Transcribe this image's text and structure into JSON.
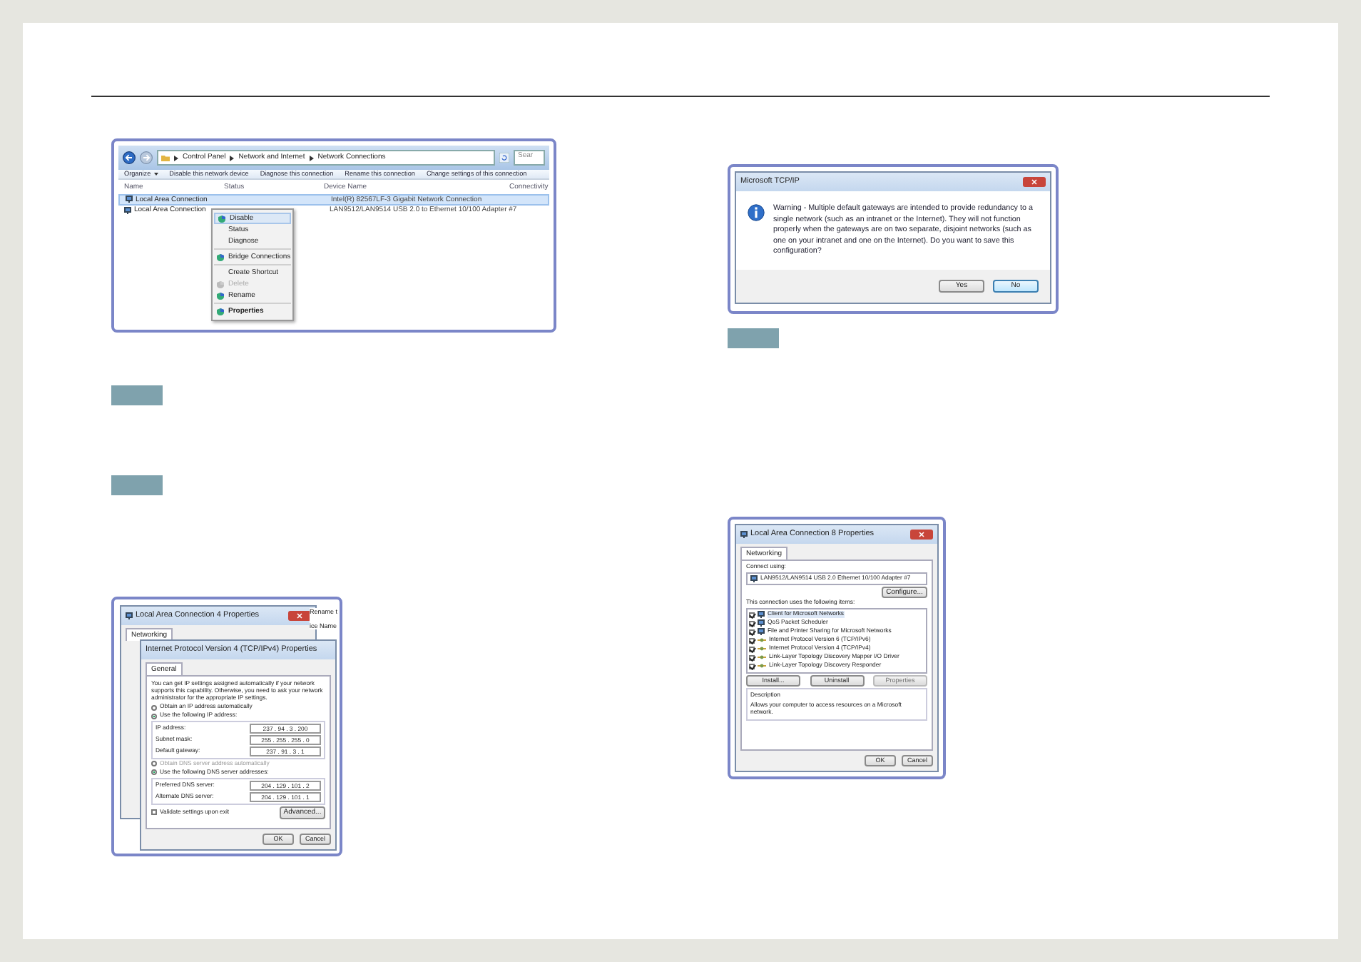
{
  "explorer": {
    "breadcrumb": [
      "Control Panel",
      "Network and Internet",
      "Network Connections"
    ],
    "search": "Sear",
    "toolbar": [
      "Organize",
      "Disable this network device",
      "Diagnose this connection",
      "Rename this connection",
      "Change settings of this connection"
    ],
    "columns": [
      "Name",
      "Status",
      "Device Name",
      "Connectivity"
    ],
    "rows": [
      {
        "name": "Local Area Connection",
        "device": "Intel(R) 82567LF-3 Gigabit Network Connection",
        "selected": true
      },
      {
        "name": "Local Area Connection",
        "device": "LAN9512/LAN9514 USB 2.0 to Ethernet 10/100 Adapter #7",
        "selected": false
      }
    ],
    "menu": [
      [
        {
          "label": "Disable",
          "kind": "shield",
          "selected": true,
          "disabled": false,
          "default": false
        },
        {
          "label": "Status",
          "kind": "plain",
          "selected": false,
          "disabled": false,
          "default": false
        },
        {
          "label": "Diagnose",
          "kind": "plain",
          "selected": false,
          "disabled": false,
          "default": false
        }
      ],
      [
        {
          "label": "Bridge Connections",
          "kind": "shield",
          "selected": false,
          "disabled": false,
          "default": false
        }
      ],
      [
        {
          "label": "Create Shortcut",
          "kind": "plain",
          "selected": false,
          "disabled": false,
          "default": false
        },
        {
          "label": "Delete",
          "kind": "shield",
          "selected": false,
          "disabled": true,
          "default": false
        },
        {
          "label": "Rename",
          "kind": "shield",
          "selected": false,
          "disabled": false,
          "default": false
        }
      ],
      [
        {
          "label": "Properties",
          "kind": "shield",
          "selected": false,
          "disabled": false,
          "default": true
        }
      ]
    ]
  },
  "warning": {
    "title": "Microsoft TCP/IP",
    "message": "Warning - Multiple default gateways are intended to provide redundancy to a single network (such as an intranet or the Internet). They will not function properly when the gateways are on two separate, disjoint networks (such as one on your intranet and one on the Internet). Do you want to save this configuration?",
    "buttons": [
      {
        "label": "Yes",
        "selected": false
      },
      {
        "label": "No",
        "selected": true
      }
    ]
  },
  "ipv4": {
    "back_title": "Local Area Connection 4 Properties",
    "back_tab": "Networking",
    "behind_button": "Rename t",
    "behind_column": "ice Name",
    "title": "Internet Protocol Version 4 (TCP/IPv4) Properties",
    "tab": "General",
    "intro": "You can get IP settings assigned automatically if your network supports this capability. Otherwise, you need to ask your network administrator for the appropriate IP settings.",
    "ip_options": [
      {
        "label": "Obtain an IP address automatically",
        "selected": false,
        "disabled": false
      },
      {
        "label": "Use the following IP address:",
        "selected": true,
        "disabled": false
      }
    ],
    "ip_fields": [
      {
        "label": "IP address:",
        "value": "237 . 94 . 3 . 200"
      },
      {
        "label": "Subnet mask:",
        "value": "255 . 255 . 255 . 0"
      },
      {
        "label": "Default gateway:",
        "value": "237 . 91 . 3 . 1"
      }
    ],
    "dns_options": [
      {
        "label": "Obtain DNS server address automatically",
        "selected": false,
        "disabled": true
      },
      {
        "label": "Use the following DNS server addresses:",
        "selected": true,
        "disabled": false
      }
    ],
    "dns_fields": [
      {
        "label": "Preferred DNS server:",
        "value": "204 . 129 . 101 . 2"
      },
      {
        "label": "Alternate DNS server:",
        "value": "204 . 129 . 101 . 1"
      }
    ],
    "validate": {
      "label": "Validate settings upon exit",
      "checked": false
    },
    "advanced": "Advanced...",
    "buttons": [
      "OK",
      "Cancel"
    ]
  },
  "properties": {
    "title": "Local Area Connection 8 Properties",
    "tab": "Networking",
    "connect_label": "Connect using:",
    "adapter": "LAN9512/LAN9514 USB 2.0 Ethernet 10/100 Adapter #7",
    "configure": "Configure...",
    "items_label": "This connection uses the following items:",
    "items": [
      {
        "label": "Client for Microsoft Networks",
        "kind": "network",
        "checked": true,
        "selected": true
      },
      {
        "label": "QoS Packet Scheduler",
        "kind": "network",
        "checked": true,
        "selected": false
      },
      {
        "label": "File and Printer Sharing for Microsoft Networks",
        "kind": "network",
        "checked": true,
        "selected": false
      },
      {
        "label": "Internet Protocol Version 6 (TCP/IPv6)",
        "kind": "protocol",
        "checked": true,
        "selected": false
      },
      {
        "label": "Internet Protocol Version 4 (TCP/IPv4)",
        "kind": "protocol",
        "checked": true,
        "selected": false
      },
      {
        "label": "Link-Layer Topology Discovery Mapper I/O Driver",
        "kind": "protocol",
        "checked": true,
        "selected": false
      },
      {
        "label": "Link-Layer Topology Discovery Responder",
        "kind": "protocol",
        "checked": true,
        "selected": false
      }
    ],
    "actions": [
      {
        "label": "Install...",
        "disabled": false
      },
      {
        "label": "Uninstall",
        "disabled": false
      },
      {
        "label": "Properties",
        "disabled": true
      }
    ],
    "description_label": "Description",
    "description": "Allows your computer to access resources on a Microsoft network.",
    "buttons": [
      "OK",
      "Cancel"
    ]
  }
}
